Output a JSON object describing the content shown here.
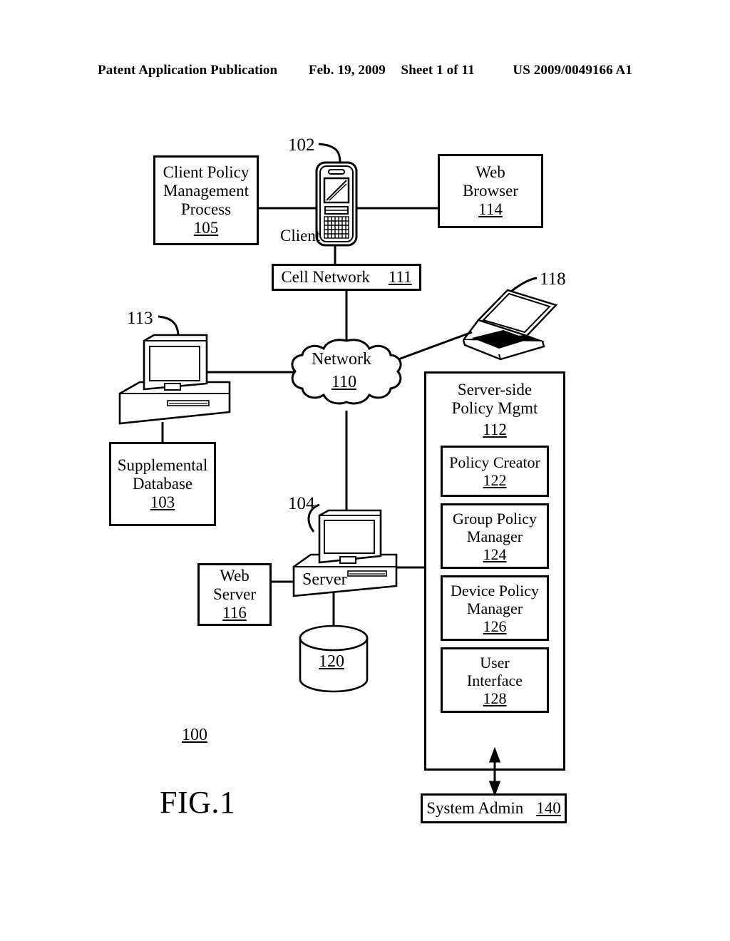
{
  "header": {
    "publication": "Patent Application Publication",
    "date": "Feb. 19, 2009",
    "sheet": "Sheet 1 of 11",
    "patent_number": "US 2009/0049166 A1"
  },
  "figure": {
    "label": "FIG.1",
    "system_ref": "100"
  },
  "nodes": {
    "client_policy_management_process": {
      "line1": "Client Policy",
      "line2": "Management",
      "line3": "Process",
      "ref": "105"
    },
    "client_device": {
      "callout": "102",
      "label": "Client"
    },
    "web_browser": {
      "line1": "Web",
      "line2": "Browser",
      "ref": "114"
    },
    "cell_network": {
      "label": "Cell Network",
      "ref": "111"
    },
    "network_cloud": {
      "label": "Network",
      "ref": "110"
    },
    "laptop": {
      "callout": "118"
    },
    "workstation": {
      "callout": "113"
    },
    "supplemental_database": {
      "line1": "Supplemental",
      "line2": "Database",
      "ref": "103"
    },
    "server": {
      "callout": "104",
      "label": "Server"
    },
    "web_server": {
      "line1": "Web",
      "line2": "Server",
      "ref": "116"
    },
    "server_database": {
      "ref": "120"
    },
    "system_admin": {
      "label": "System Admin",
      "ref": "140"
    }
  },
  "policy_panel": {
    "title_line1": "Server-side",
    "title_line2": "Policy Mgmt",
    "ref": "112",
    "modules": [
      {
        "line1": "Policy Creator",
        "line2": "",
        "ref": "122"
      },
      {
        "line1": "Group Policy",
        "line2": "Manager",
        "ref": "124"
      },
      {
        "line1": "Device Policy",
        "line2": "Manager",
        "ref": "126"
      },
      {
        "line1": "User",
        "line2": "Interface",
        "ref": "128"
      }
    ]
  },
  "colors": {
    "ink": "#000000",
    "paper": "#ffffff"
  }
}
